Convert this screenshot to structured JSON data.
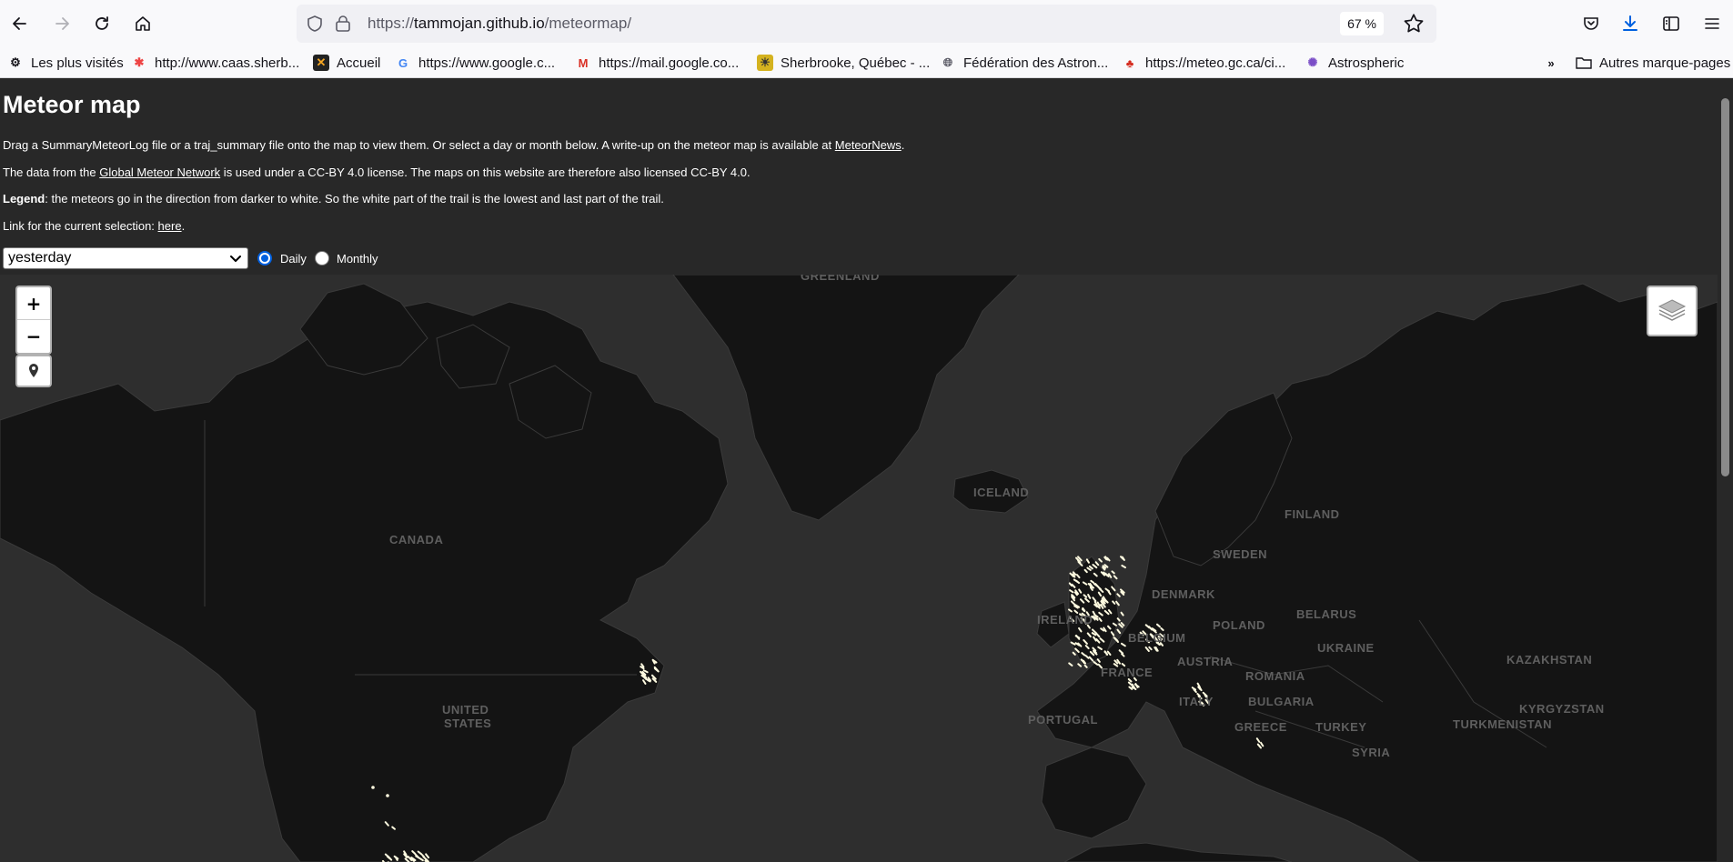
{
  "browser": {
    "url_scheme": "https://",
    "url_host": "tammojan.github.io",
    "url_path": "/meteormap/",
    "zoom": "67 %",
    "bookmarks": [
      {
        "label": "Les plus visités",
        "icon": "gear-icon"
      },
      {
        "label": "http://www.caas.sherb...",
        "icon": "joomla-icon"
      },
      {
        "label": "Accueil",
        "icon": "app-icon"
      },
      {
        "label": "https://www.google.c...",
        "icon": "google-icon"
      },
      {
        "label": "https://mail.google.co...",
        "icon": "gmail-icon"
      },
      {
        "label": "Sherbrooke, Québec - ...",
        "icon": "weather-icon"
      },
      {
        "label": "Fédération des Astron...",
        "icon": "globe-icon"
      },
      {
        "label": "https://meteo.gc.ca/ci...",
        "icon": "maple-leaf-icon"
      },
      {
        "label": "Astrospheric",
        "icon": "astrospheric-icon"
      }
    ],
    "other_bookmarks": "Autres marque-pages"
  },
  "page": {
    "title": "Meteor map",
    "intro_text": "Drag a SummaryMeteorLog file or a traj_summary file onto the map to view them. Or select a day or month below. A write-up on the meteor map is available at ",
    "intro_link": "MeteorNews",
    "intro_end": ".",
    "data_text_1": "The data from the ",
    "data_link": "Global Meteor Network",
    "data_text_2": " is used under a CC-BY 4.0 license. The maps on this website are therefore also licensed CC-BY 4.0.",
    "legend_label": "Legend",
    "legend_text": ": the meteors go in the direction from darker to white. So the white part of the trail is the lowest and last part of the trail.",
    "link_text": "Link for the current selection: ",
    "link_anchor": "here",
    "link_end": ".",
    "select_value": "yesterday",
    "radio_daily": "Daily",
    "radio_monthly": "Monthly",
    "selected_mode": "Daily"
  },
  "map": {
    "zoom_in": "+",
    "zoom_out": "−",
    "labels": {
      "greenland": "GREENLAND",
      "iceland": "ICELAND",
      "finland": "FINLAND",
      "canada": "CANADA",
      "sweden": "SWEDEN",
      "denmark": "DENMARK",
      "ireland": "IRELAND",
      "poland": "POLAND",
      "belarus": "BELARUS",
      "belgium": "BELGIUM",
      "ukraine": "UKRAINE",
      "kazakhstan": "KAZAKHSTAN",
      "france": "FRANCE",
      "austria": "AUSTRIA",
      "romania": "ROMANIA",
      "italy": "ITALY",
      "bulgaria": "BULGARIA",
      "united": "UNITED",
      "states": "STATES",
      "portugal": "PORTUGAL",
      "greece": "GREECE",
      "turkey": "TURKEY",
      "kyrgyzstan": "KYRGYZSTAN",
      "turkmenistan": "TURKMENISTAN",
      "syria": "SYRIA"
    },
    "meteor_color": "#fffbe0",
    "land_color": "#141414",
    "sea_color": "#2e2e2e"
  }
}
